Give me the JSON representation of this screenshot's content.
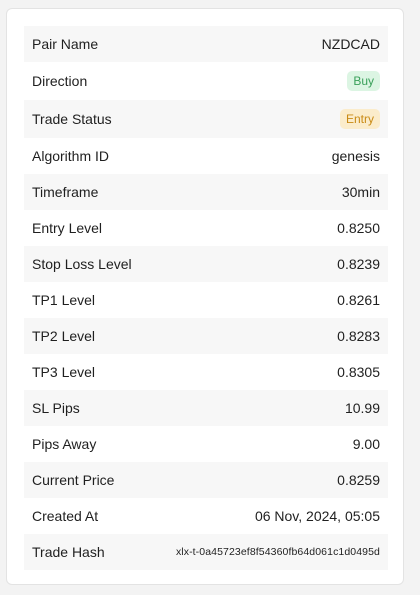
{
  "rows": [
    {
      "label": "Pair Name",
      "value": "NZDCAD"
    },
    {
      "label": "Direction",
      "value": "Buy"
    },
    {
      "label": "Trade Status",
      "value": "Entry"
    },
    {
      "label": "Algorithm ID",
      "value": "genesis"
    },
    {
      "label": "Timeframe",
      "value": "30min"
    },
    {
      "label": "Entry Level",
      "value": "0.8250"
    },
    {
      "label": "Stop Loss Level",
      "value": "0.8239"
    },
    {
      "label": "TP1 Level",
      "value": "0.8261"
    },
    {
      "label": "TP2 Level",
      "value": "0.8283"
    },
    {
      "label": "TP3 Level",
      "value": "0.8305"
    },
    {
      "label": "SL Pips",
      "value": "10.99"
    },
    {
      "label": "Pips Away",
      "value": "9.00"
    },
    {
      "label": "Current Price",
      "value": "0.8259"
    },
    {
      "label": "Created At",
      "value": "06 Nov, 2024, 05:05"
    },
    {
      "label": "Trade Hash",
      "value": "xlx-t-0a45723ef8f54360fb64d061c1d0495d"
    }
  ],
  "colors": {
    "buy_badge_bg": "#dcf5e3",
    "buy_badge_text": "#3aa05a",
    "entry_badge_bg": "#fbeccb",
    "entry_badge_text": "#c98a14"
  }
}
